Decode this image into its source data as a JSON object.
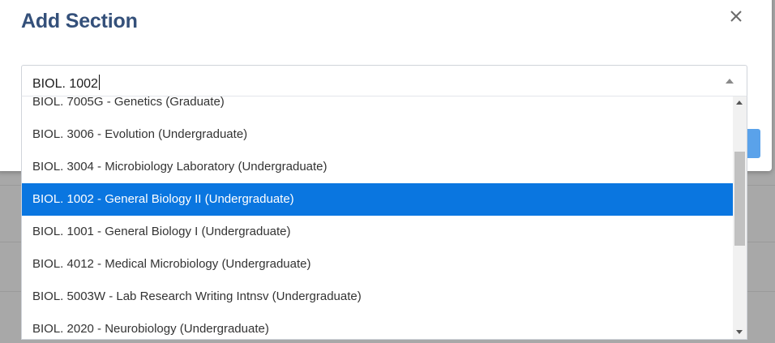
{
  "modal": {
    "title": "Add Section",
    "close_icon": "close-icon"
  },
  "select": {
    "value": "BIOL. 1002",
    "arrow_icon": "chevron-up-icon",
    "options": [
      "BIOL. 7005G - Genetics (Graduate)",
      "BIOL. 3006 - Evolution (Undergraduate)",
      "BIOL. 3004 - Microbiology Laboratory (Undergraduate)",
      "BIOL. 1002 - General Biology II (Undergraduate)",
      "BIOL. 1001 - General Biology I (Undergraduate)",
      "BIOL. 4012 - Medical Microbiology (Undergraduate)",
      "BIOL. 5003W - Lab Research Writing Intnsv (Undergraduate)",
      "BIOL. 2020 - Neurobiology (Undergraduate)"
    ],
    "selected_index": 3
  },
  "colors": {
    "title": "#34507a",
    "highlight": "#0a76e0",
    "primary_button": "#5aa2ea"
  }
}
